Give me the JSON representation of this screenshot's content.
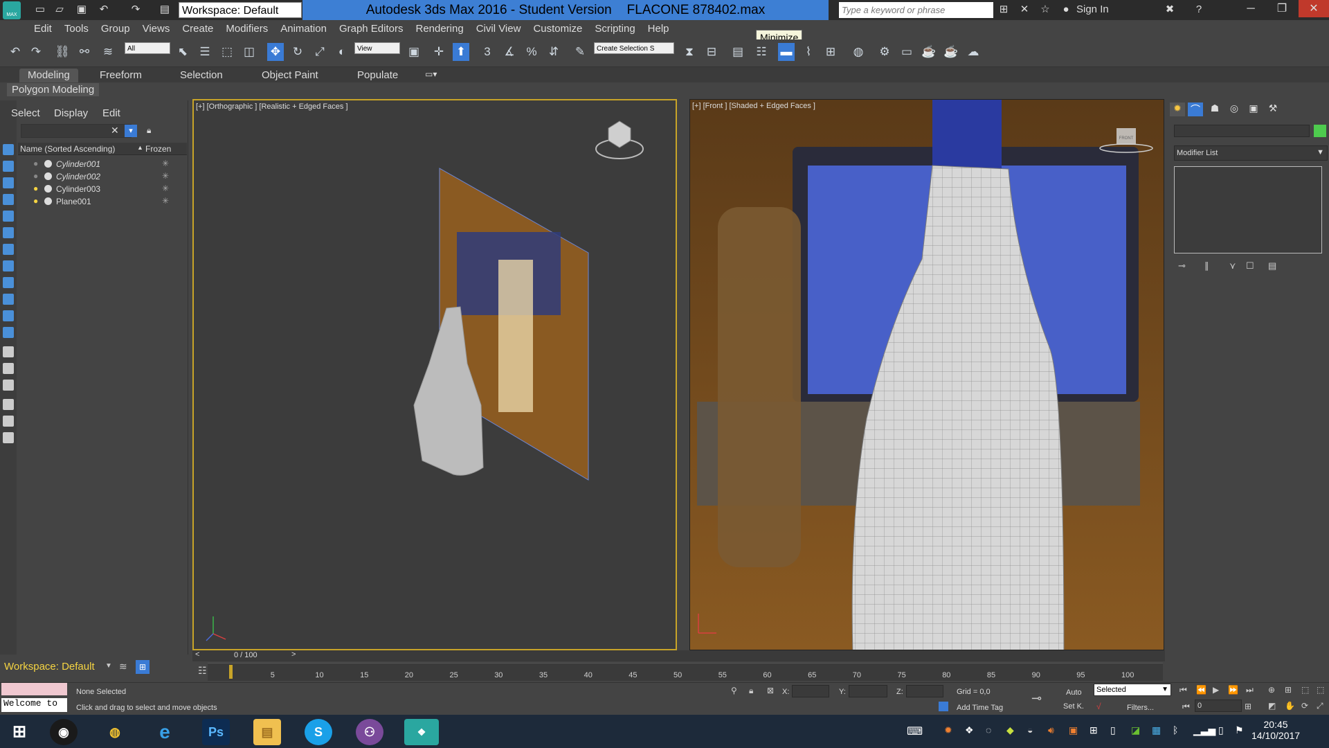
{
  "app": {
    "window_title": "Autodesk 3ds Max 2016 - Student Version",
    "file_name": "FLACONE 878402.max",
    "logo_text": "MAX",
    "workspace": "Workspace: Default",
    "search_placeholder": "Type a keyword or phrase",
    "signin": "Sign In",
    "tooltip": "Minimize"
  },
  "menu": [
    "Edit",
    "Tools",
    "Group",
    "Views",
    "Create",
    "Modifiers",
    "Animation",
    "Graph Editors",
    "Rendering",
    "Civil View",
    "Customize",
    "Scripting",
    "Help"
  ],
  "toolbar": {
    "filter_select": "All",
    "refcoord_select": "View",
    "selection_set": "Create Selection S"
  },
  "ribbon": {
    "tabs": [
      "Modeling",
      "Freeform",
      "Selection",
      "Object Paint",
      "Populate"
    ],
    "active_tab": "Modeling",
    "panel_button": "Polygon Modeling"
  },
  "scene_explorer": {
    "menu": [
      "Select",
      "Display",
      "Edit"
    ],
    "col_name": "Name (Sorted Ascending)",
    "col_frozen": "Frozen",
    "rows": [
      "Cylinder001",
      "Cylinder002",
      "Cylinder003",
      "Plane001"
    ]
  },
  "viewports": {
    "left_label": "[+] [Orthographic ] [Realistic + Edged Faces ]",
    "right_label": "[+] [Front ] [Shaded + Edged Faces ]",
    "viewcube_front": "FRONT"
  },
  "command_panel": {
    "modifier_list": "Modifier List"
  },
  "timeline": {
    "frame": "0 / 100",
    "ticks": [
      "5",
      "10",
      "15",
      "20",
      "25",
      "30",
      "35",
      "40",
      "45",
      "50",
      "55",
      "60",
      "65",
      "70",
      "75",
      "80",
      "85",
      "90",
      "95",
      "100"
    ]
  },
  "status": {
    "workspace": "Workspace: Default",
    "listener": "Welcome to",
    "selection": "None Selected",
    "prompt": "Click and drag to select and move objects",
    "x_label": "X:",
    "y_label": "Y:",
    "z_label": "Z:",
    "grid": "Grid = 0,0",
    "add_time_tag": "Add Time Tag",
    "auto": "Auto",
    "set_key": "Set K.",
    "key_mode": "Selected",
    "filters": "Filters...",
    "current_frame": "0"
  },
  "taskbar": {
    "time": "20:45",
    "date": "14/10/2017",
    "apps": [
      "start",
      "chrome",
      "ie",
      "Ps",
      "explorer",
      "skype",
      "github",
      "3dsmax"
    ]
  },
  "colors": {
    "title_blue": "#3d7fd4",
    "active_viewport_border": "#c8a428",
    "accent_blue": "#3a7bd5"
  }
}
